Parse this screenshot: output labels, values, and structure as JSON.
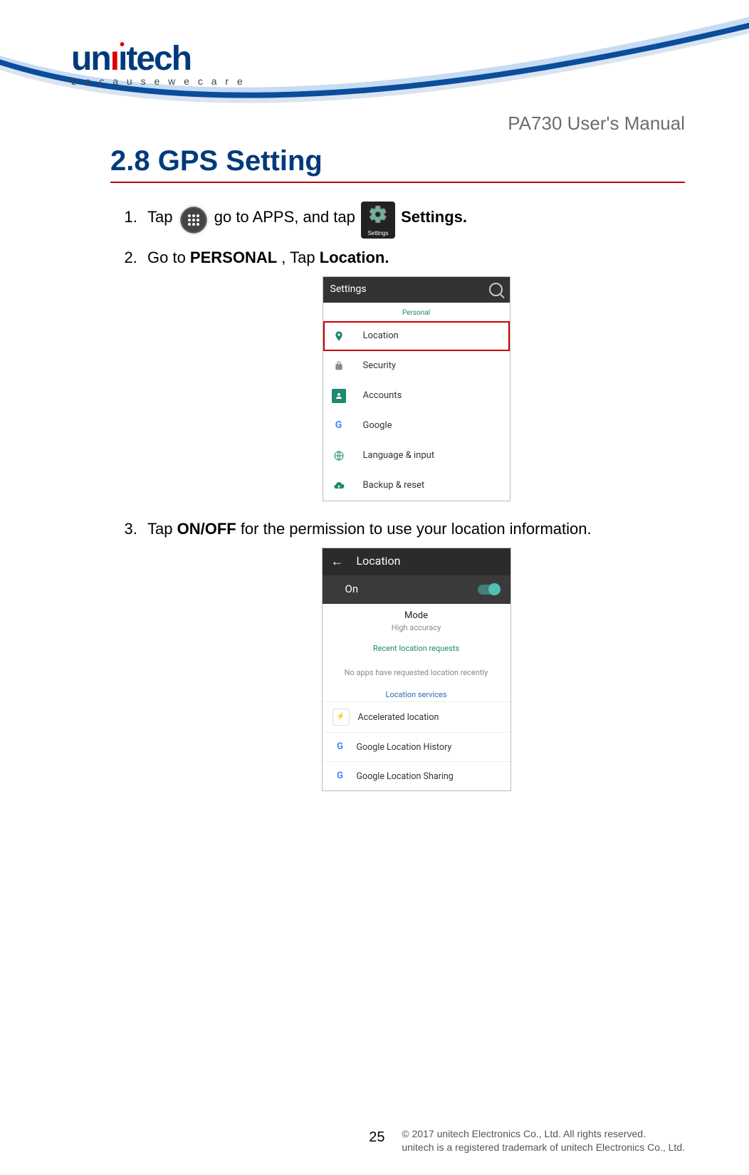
{
  "header": {
    "logo_text": "unitech",
    "tagline": "b e c a u s e  w e  c a r e",
    "doc_title": "PA730 User's Manual"
  },
  "section": {
    "title": "2.8 GPS Setting"
  },
  "steps": {
    "s1_num": "1.",
    "s1_tap": "Tap",
    "s1_goapps": " go to APPS, and tap ",
    "s1_settings_label": "Settings",
    "s1_settings_bold": "Settings.",
    "s2_num": "2.",
    "s2_pre": "Go to ",
    "s2_personal": "PERSONAL",
    "s2_mid": " , Tap ",
    "s2_location": "Location.",
    "s3_num": "3.",
    "s3_pre": "Tap ",
    "s3_onoff": "ON/OFF",
    "s3_post": " for the permission to use your location information."
  },
  "shot1": {
    "bar_title": "Settings",
    "section_label": "Personal",
    "rows": [
      {
        "label": "Location"
      },
      {
        "label": "Security"
      },
      {
        "label": "Accounts"
      },
      {
        "label": "Google"
      },
      {
        "label": "Language & input"
      },
      {
        "label": "Backup & reset"
      }
    ]
  },
  "shot2": {
    "bar_title": "Location",
    "on_label": "On",
    "mode_title": "Mode",
    "mode_sub": "High accuracy",
    "recent_label": "Recent location requests",
    "recent_empty": "No apps have requested location recently",
    "services_label": "Location services",
    "services": [
      {
        "label": "Accelerated location"
      },
      {
        "label": "Google Location History"
      },
      {
        "label": "Google Location Sharing"
      }
    ]
  },
  "footer": {
    "page_num": "25",
    "line1": "© 2017 unitech Electronics Co., Ltd. All rights reserved.",
    "line2": "unitech is a registered trademark of unitech Electronics Co., Ltd."
  }
}
